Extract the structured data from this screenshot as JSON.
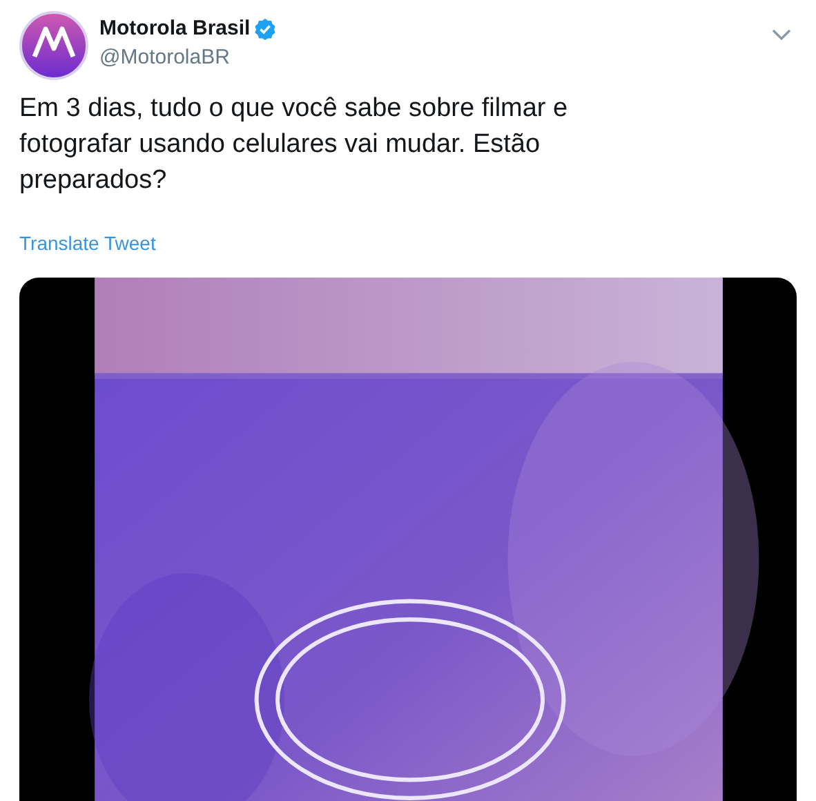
{
  "tweet": {
    "author": {
      "name": "Motorola Brasil",
      "handle": "@MotorolaBR",
      "verified": true
    },
    "text": "Em 3 dias, tudo o que você sabe sobre filmar e fotografar usando celulares vai mudar. Estão preparados?",
    "translate_link": "Translate Tweet"
  }
}
